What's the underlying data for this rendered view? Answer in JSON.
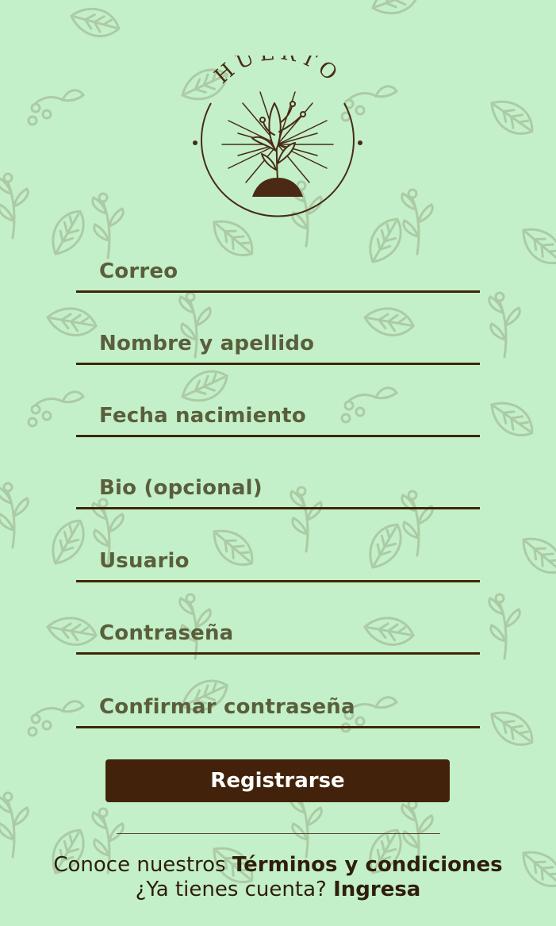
{
  "brand": {
    "name": "HUERTO"
  },
  "form": {
    "fields": [
      {
        "label": "Correo"
      },
      {
        "label": "Nombre y apellido"
      },
      {
        "label": "Fecha nacimiento"
      },
      {
        "label": "Bio (opcional)"
      },
      {
        "label": "Usuario"
      },
      {
        "label": "Contraseña"
      },
      {
        "label": "Confirmar contraseña"
      }
    ],
    "submit_label": "Registrarse"
  },
  "footer": {
    "terms_prefix": "Conoce nuestros",
    "terms_link": "Términos y condiciones",
    "login_prefix": "¿Ya tienes cuenta?",
    "login_link": "Ingresa"
  },
  "colors": {
    "background": "#c3f0c8",
    "accent": "#42220a",
    "label": "#5a5e3c"
  }
}
